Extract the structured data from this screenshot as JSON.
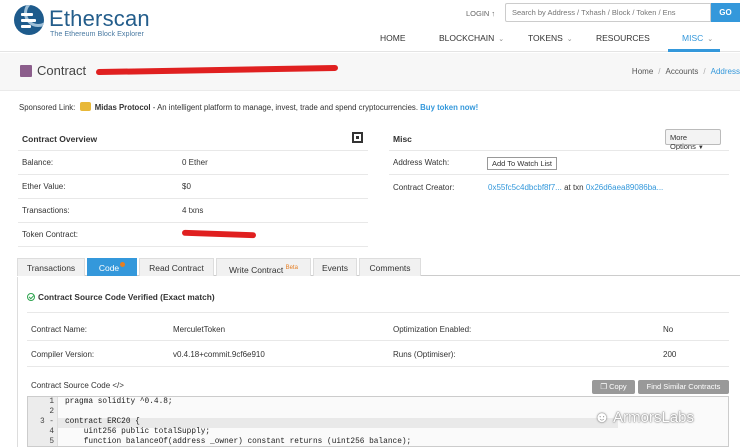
{
  "header": {
    "brand": "Etherscan",
    "tagline": "The Ethereum Block Explorer",
    "login": "LOGIN ↑",
    "search_placeholder": "Search by Address / Txhash / Block / Token / Ens",
    "go_label": "GO",
    "nav": [
      {
        "label": "HOME",
        "has_chevron": false
      },
      {
        "label": "BLOCKCHAIN",
        "has_chevron": true
      },
      {
        "label": "TOKENS",
        "has_chevron": true
      },
      {
        "label": "RESOURCES",
        "has_chevron": false
      },
      {
        "label": "MISC",
        "has_chevron": true,
        "active": true
      }
    ],
    "accent_color": "#3498db"
  },
  "titlebar": {
    "title": "Contract",
    "breadcrumb": [
      "Home",
      "Accounts",
      "Address"
    ]
  },
  "sponsored": {
    "prefix": "Sponsored Link:",
    "name": "Midas Protocol",
    "text": " - An intelligent platform to manage, invest, trade and spend cryptocurrencies.",
    "cta": "Buy token now!"
  },
  "overview": {
    "heading": "Contract Overview",
    "rows": [
      {
        "label": "Balance:",
        "value": "0 Ether"
      },
      {
        "label": "Ether Value:",
        "value": "$0"
      },
      {
        "label": "Transactions:",
        "value": "4 txns"
      },
      {
        "label": "Token Contract:",
        "value": ""
      }
    ]
  },
  "misc": {
    "heading": "Misc",
    "more_options": "More Options",
    "address_watch_label": "Address Watch:",
    "watch_button": "Add To Watch List",
    "creator_label": "Contract Creator:",
    "creator_address": "0x55fc5c4dbcbf8f7...",
    "at_txn": "at txn",
    "creator_txn": "0x26d6aea89086ba..."
  },
  "tabs": [
    {
      "label": "Transactions"
    },
    {
      "label": "Code",
      "active": true
    },
    {
      "label": "Read Contract"
    },
    {
      "label": "Write Contract",
      "badge": "Beta"
    },
    {
      "label": "Events"
    },
    {
      "label": "Comments"
    }
  ],
  "code_section": {
    "verified": "Contract Source Code Verified (Exact match)",
    "details": [
      {
        "label": "Contract Name:",
        "value": "MerculetToken"
      },
      {
        "label": "Compiler Version:",
        "value": "v0.4.18+commit.9cf6e910"
      },
      {
        "label": "Optimization Enabled:",
        "value": "No"
      },
      {
        "label": "Runs (Optimiser):",
        "value": "200"
      }
    ],
    "source_label": "Contract Source Code </>",
    "copy_button": "Copy",
    "similar_button": "Find Similar Contracts",
    "lines": [
      {
        "num": "1",
        "text": "pragma solidity ^0.4.8;"
      },
      {
        "num": "2",
        "text": ""
      },
      {
        "num": "3 -",
        "text": "contract ERC20 {"
      },
      {
        "num": "4",
        "text": "    uint256 public totalSupply;"
      },
      {
        "num": "5",
        "text": "    function balanceOf(address _owner) constant returns (uint256 balance);"
      }
    ]
  },
  "watermark": "ArmorsLabs"
}
